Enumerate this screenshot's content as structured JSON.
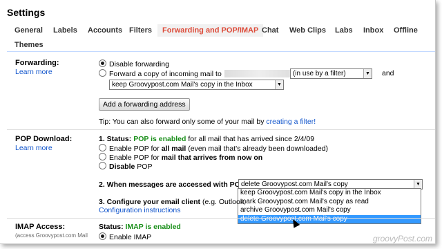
{
  "page_title": "Settings",
  "tabs": [
    {
      "label": "General"
    },
    {
      "label": "Labels"
    },
    {
      "label": "Accounts"
    },
    {
      "label": "Filters"
    },
    {
      "label": "Forwarding and POP/IMAP",
      "active": true
    },
    {
      "label": "Chat"
    },
    {
      "label": "Web Clips"
    },
    {
      "label": "Labs"
    },
    {
      "label": "Inbox"
    },
    {
      "label": "Offline"
    },
    {
      "label": "Themes"
    }
  ],
  "forwarding": {
    "label": "Forwarding:",
    "learn_more": "Learn more",
    "option_disable": "Disable forwarding",
    "option_forward_prefix": "Forward a copy of incoming mail to",
    "address_select": "(in use by a filter)",
    "and_text": "and",
    "action_select": "keep Groovypost.com Mail's copy in the Inbox",
    "add_button": "Add a forwarding address",
    "tip_prefix": "Tip: You can also forward only some of your mail by",
    "tip_link": "creating a filter!"
  },
  "pop": {
    "label": "POP Download:",
    "learn_more": "Learn more",
    "status_num": "1. Status:",
    "status_value": "POP is enabled",
    "status_suffix": "for all mail that has arrived since 2/4/09",
    "opt1_prefix": "Enable POP for",
    "opt1_bold": "all mail",
    "opt1_suffix": "(even mail that's already been downloaded)",
    "opt2_prefix": "Enable POP for",
    "opt2_bold": "mail that arrives from now on",
    "opt3_bold": "Disable",
    "opt3_suffix": "POP",
    "when_label": "2. When messages are accessed with POP",
    "when_selected": "delete Groovypost.com Mail's copy",
    "dropdown_options": [
      "keep Groovypost.com Mail's copy in the Inbox",
      "mark Groovypost.com Mail's copy as read",
      "archive Groovypost.com Mail's copy",
      "delete Groovypost.com Mail's copy"
    ],
    "configure_label": "3. Configure your email client",
    "configure_suffix": "(e.g. Outlook,",
    "config_link": "Configuration instructions"
  },
  "imap": {
    "label": "IMAP Access:",
    "sub": "(access Groovypost.com Mail",
    "status_prefix": "Status:",
    "status_value": "IMAP is enabled",
    "enable": "Enable IMAP"
  },
  "watermark": "groovyPost.com"
}
